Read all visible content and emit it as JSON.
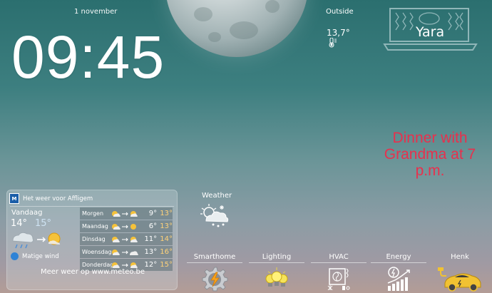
{
  "header": {
    "date": "1 november",
    "time": "09:45",
    "outside_label": "Outside",
    "outside_temp": "13,7°"
  },
  "user": {
    "name": "Yara"
  },
  "reminder": "Dinner with Grandma at 7 p.m.",
  "weather_tile": {
    "label": "Weather"
  },
  "widget": {
    "logo_text": "M",
    "title": "Het weer voor Affligem",
    "today": {
      "label": "Vandaag",
      "max": "14°",
      "min": "15°",
      "wind": "Matige wind"
    },
    "forecast": [
      {
        "day": "Morgen",
        "max": "9°",
        "min": "13°"
      },
      {
        "day": "Maandag",
        "max": "6°",
        "min": "13°"
      },
      {
        "day": "Dinsdag",
        "max": "11°",
        "min": "14°"
      },
      {
        "day": "Woensdag",
        "max": "13°",
        "min": "16°"
      },
      {
        "day": "Donderdag",
        "max": "12°",
        "min": "15°"
      }
    ],
    "more_link": "Meer weer op www.meteo.be"
  },
  "tiles": [
    {
      "label": "Smarthome",
      "icon": "gear-lightning-icon"
    },
    {
      "label": "Lighting",
      "icon": "bulbs-icon"
    },
    {
      "label": "HVAC",
      "icon": "hvac-icon"
    },
    {
      "label": "Energy",
      "icon": "energy-chart-icon"
    },
    {
      "label": "Henk",
      "icon": "car-charging-icon"
    }
  ],
  "colors": {
    "reminder": "#e8304d",
    "energy_accent": "#f1c232"
  }
}
